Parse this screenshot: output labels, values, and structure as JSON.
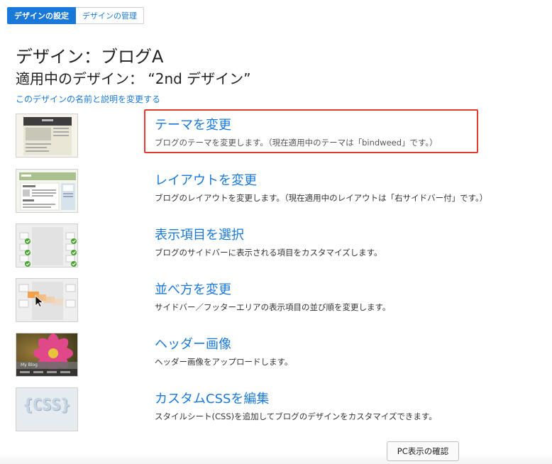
{
  "tabs": [
    {
      "label": "デザインの設定",
      "active": true
    },
    {
      "label": "デザインの管理",
      "active": false
    }
  ],
  "page": {
    "title": "デザイン：ブログA",
    "current_design": "適用中のデザイン： “2nd デザイン”",
    "edit_link": "このデザインの名前と説明を変更する"
  },
  "items": [
    {
      "title": "テーマを変更",
      "desc": "ブログのテーマを変更します。（現在適用中のテーマは「bindweed」です。）",
      "thumb_icon": "theme-thumbnail"
    },
    {
      "title": "レイアウトを変更",
      "desc": "ブログのレイアウトを変更します。（現在適用中のレイアウトは「右サイドバー付」です。）",
      "thumb_icon": "layout-thumbnail"
    },
    {
      "title": "表示項目を選択",
      "desc": "ブログのサイドバーに表示される項目をカスタマイズします。",
      "thumb_icon": "checklist-thumbnail"
    },
    {
      "title": "並べ方を変更",
      "desc": "サイドバー／フッターエリアの表示項目の並び順を変更します。",
      "thumb_icon": "reorder-thumbnail"
    },
    {
      "title": "ヘッダー画像",
      "desc": "ヘッダー画像をアップロードします。",
      "thumb_icon": "header-image-thumbnail",
      "thumb_caption": "My Blog"
    },
    {
      "title": "カスタムCSSを編集",
      "desc": "スタイルシート(CSS)を追加してブログのデザインをカスタマイズできます。",
      "thumb_icon": "css-thumbnail",
      "thumb_text": "{CSS}"
    }
  ],
  "footer": {
    "pc_preview_label": "PC表示の確認"
  },
  "colors": {
    "accent": "#1a78d8",
    "highlight": "#e53b2f"
  }
}
